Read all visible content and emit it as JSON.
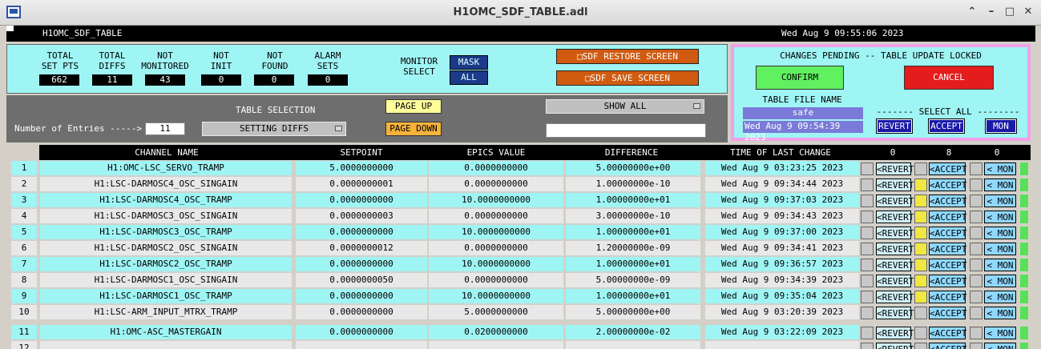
{
  "window": {
    "title": "H1OMC_SDF_TABLE.adl"
  },
  "header": {
    "screen_name": "H1OMC_SDF_TABLE",
    "datetime": "Wed Aug  9 09:55:06 2023"
  },
  "stats": [
    {
      "label1": "TOTAL",
      "label2": "SET PTS",
      "value": "662"
    },
    {
      "label1": "TOTAL",
      "label2": "DIFFS",
      "value": "11"
    },
    {
      "label1": "NOT",
      "label2": "MONITORED",
      "value": "43"
    },
    {
      "label1": "NOT",
      "label2": "INIT",
      "value": "0"
    },
    {
      "label1": "NOT",
      "label2": "FOUND",
      "value": "0"
    },
    {
      "label1": "ALARM",
      "label2": "SETS",
      "value": "0"
    }
  ],
  "monitor_select": {
    "label1": "MONITOR",
    "label2": "SELECT",
    "mask_label": "MASK",
    "all_label": "ALL"
  },
  "screens": {
    "restore_label": "□SDF RESTORE SCREEN",
    "save_label": "□SDF SAVE SCREEN"
  },
  "pending": {
    "status": "CHANGES PENDING -- TABLE UPDATE LOCKED",
    "confirm_label": "CONFIRM",
    "cancel_label": "CANCEL",
    "file_name_label": "TABLE FILE NAME",
    "file_name_value": "safe",
    "file_time": "Wed Aug  9 09:54:39 2023",
    "select_all_label": "------- SELECT ALL --------",
    "revert_all_label": "REVERT",
    "accept_all_label": "ACCEPT",
    "mon_all_label": "MON"
  },
  "selection": {
    "entries_label": "Number of Entries ----->",
    "entries_value": "11",
    "table_selection_label": "TABLE SELECTION",
    "table_selection_value": "SETTING DIFFS",
    "page_up_label": "PAGE UP",
    "page_down_label": "PAGE DOWN",
    "show_all_label": "SHOW ALL"
  },
  "columns": {
    "channel": "CHANNEL NAME",
    "setpoint": "SETPOINT",
    "epics": "EPICS VALUE",
    "difference": "DIFFERENCE",
    "time": "TIME OF LAST CHANGE",
    "count_revert": "0",
    "count_accept": "8",
    "count_mon": "0"
  },
  "row_buttons": {
    "revert": "<REVERT",
    "accept": "<ACCEPT",
    "mon": "< MON"
  },
  "colors": {
    "cyan": "#9ff4f4",
    "row_alt": "#e8e8e8",
    "accent_orange": "#d05b10",
    "confirm_green": "#60f060",
    "cancel_red": "#e51c1c"
  },
  "rows": [
    {
      "num": "1",
      "channel": "H1:OMC-LSC_SERVO_TRAMP",
      "setpoint": "5.0000000000",
      "epics": "0.0000000000",
      "difference": "5.00000000e+00",
      "time": "Wed Aug  9 03:23:25 2023",
      "accept_checked": false
    },
    {
      "num": "2",
      "channel": "H1:LSC-DARMOSC4_OSC_SINGAIN",
      "setpoint": "0.0000000001",
      "epics": "0.0000000000",
      "difference": "1.00000000e-10",
      "time": "Wed Aug  9 09:34:44 2023",
      "accept_checked": true
    },
    {
      "num": "3",
      "channel": "H1:LSC-DARMOSC4_OSC_TRAMP",
      "setpoint": "0.0000000000",
      "epics": "10.0000000000",
      "difference": "1.00000000e+01",
      "time": "Wed Aug  9 09:37:03 2023",
      "accept_checked": true
    },
    {
      "num": "4",
      "channel": "H1:LSC-DARMOSC3_OSC_SINGAIN",
      "setpoint": "0.0000000003",
      "epics": "0.0000000000",
      "difference": "3.00000000e-10",
      "time": "Wed Aug  9 09:34:43 2023",
      "accept_checked": true
    },
    {
      "num": "5",
      "channel": "H1:LSC-DARMOSC3_OSC_TRAMP",
      "setpoint": "0.0000000000",
      "epics": "10.0000000000",
      "difference": "1.00000000e+01",
      "time": "Wed Aug  9 09:37:00 2023",
      "accept_checked": true
    },
    {
      "num": "6",
      "channel": "H1:LSC-DARMOSC2_OSC_SINGAIN",
      "setpoint": "0.0000000012",
      "epics": "0.0000000000",
      "difference": "1.20000000e-09",
      "time": "Wed Aug  9 09:34:41 2023",
      "accept_checked": true
    },
    {
      "num": "7",
      "channel": "H1:LSC-DARMOSC2_OSC_TRAMP",
      "setpoint": "0.0000000000",
      "epics": "10.0000000000",
      "difference": "1.00000000e+01",
      "time": "Wed Aug  9 09:36:57 2023",
      "accept_checked": true
    },
    {
      "num": "8",
      "channel": "H1:LSC-DARMOSC1_OSC_SINGAIN",
      "setpoint": "0.0000000050",
      "epics": "0.0000000000",
      "difference": "5.00000000e-09",
      "time": "Wed Aug  9 09:34:39 2023",
      "accept_checked": true
    },
    {
      "num": "9",
      "channel": "H1:LSC-DARMOSC1_OSC_TRAMP",
      "setpoint": "0.0000000000",
      "epics": "10.0000000000",
      "difference": "1.00000000e+01",
      "time": "Wed Aug  9 09:35:04 2023",
      "accept_checked": true
    },
    {
      "num": "10",
      "channel": "H1:LSC-ARM_INPUT_MTRX_TRAMP",
      "setpoint": "0.0000000000",
      "epics": "5.0000000000",
      "difference": "5.00000000e+00",
      "time": "Wed Aug  9 03:20:39 2023",
      "accept_checked": false
    },
    {
      "num": "11",
      "channel": "H1:OMC-ASC_MASTERGAIN",
      "setpoint": "0.0000000000",
      "epics": "0.0200000000",
      "difference": "2.00000000e-02",
      "time": "Wed Aug  9 03:22:09 2023",
      "accept_checked": false
    },
    {
      "num": "12",
      "channel": "",
      "setpoint": "",
      "epics": "",
      "difference": "",
      "time": "",
      "accept_checked": false
    }
  ]
}
